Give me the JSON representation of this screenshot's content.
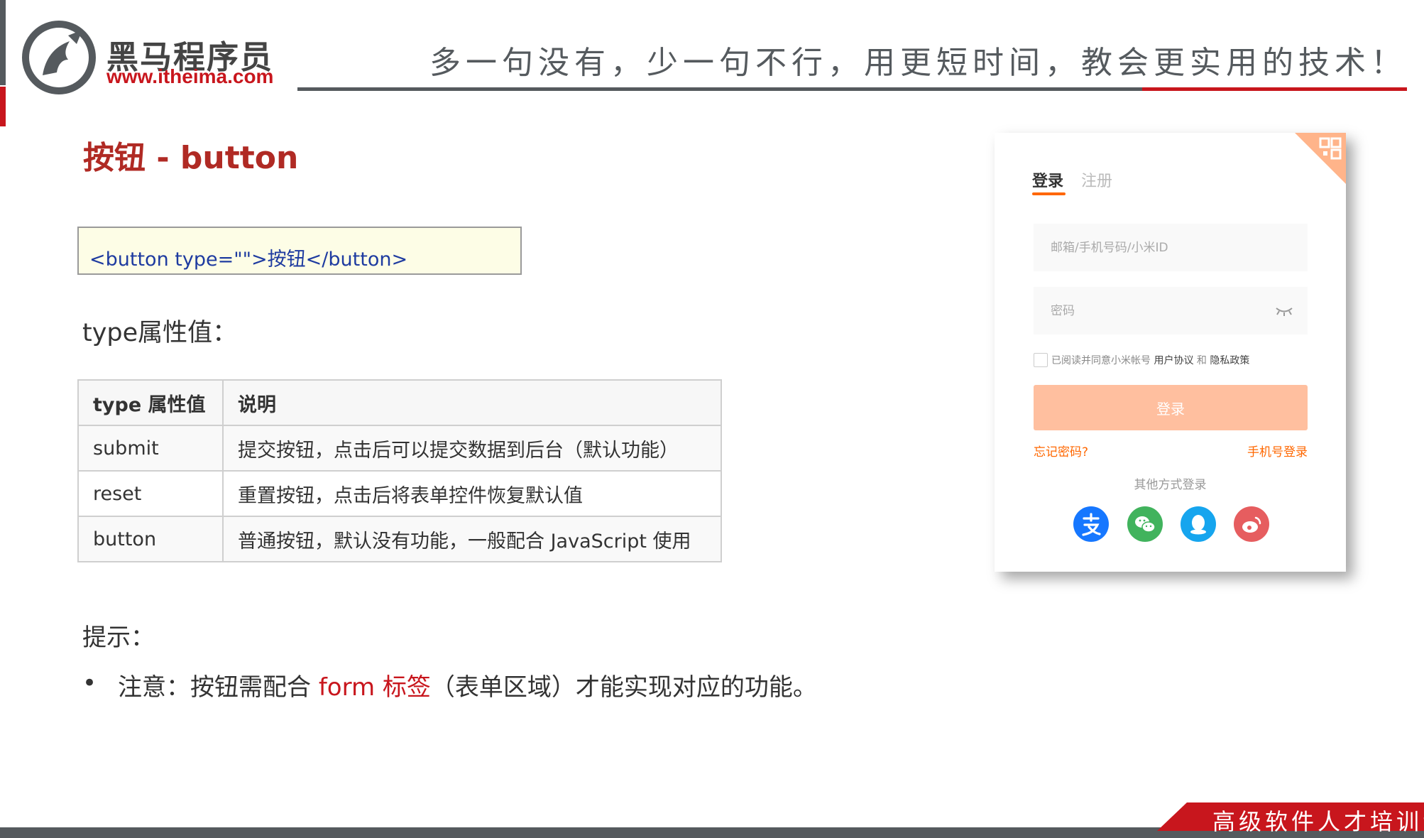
{
  "header": {
    "brand_name": "黑马程序员",
    "brand_url": "www.itheima.com",
    "slogan": "多一句没有，少一句不行，用更短时间，教会更实用的技术！"
  },
  "slide": {
    "title": "按钮 - button",
    "code": {
      "tag_open": "<button type=\"\">",
      "inner_text": "按钮",
      "tag_close": "</button>"
    },
    "type_label": "type属性值：",
    "table": {
      "headers": [
        "type 属性值",
        "说明"
      ],
      "rows": [
        [
          "submit",
          "提交按钮，点击后可以提交数据到后台（默认功能）"
        ],
        [
          "reset",
          "重置按钮，点击后将表单控件恢复默认值"
        ],
        [
          "button",
          "普通按钮，默认没有功能，一般配合 JavaScript 使用"
        ]
      ]
    },
    "tip_label": "提示：",
    "note": {
      "bullet": "•",
      "prefix": "注意：按钮需配合 ",
      "highlight": "form 标签",
      "suffix": "（表单区域）才能实现对应的功能。"
    }
  },
  "login_card": {
    "tab_login": "登录",
    "tab_register": "注册",
    "user_placeholder": "邮箱/手机号码/小米ID",
    "password_placeholder": "密码",
    "agree_prefix": "已阅读并同意小米帐号 ",
    "agree_terms": "用户协议",
    "agree_and": " 和 ",
    "agree_privacy": "隐私政策",
    "login_button": "登录",
    "forgot_link": "忘记密码?",
    "phone_login_link": "手机号登录",
    "other_login": "其他方式登录",
    "social_icons": [
      "alipay-icon",
      "wechat-icon",
      "qq-icon",
      "weibo-icon"
    ]
  },
  "footer": {
    "text": "高级软件人才培训专"
  },
  "colors": {
    "brand_red": "#c8161d",
    "brand_gray": "#555a5e",
    "title_red": "#b02a24",
    "code_blue": "#1e3ba0",
    "mi_orange": "#ff6700",
    "login_button_bg": "#ffbf9f"
  }
}
